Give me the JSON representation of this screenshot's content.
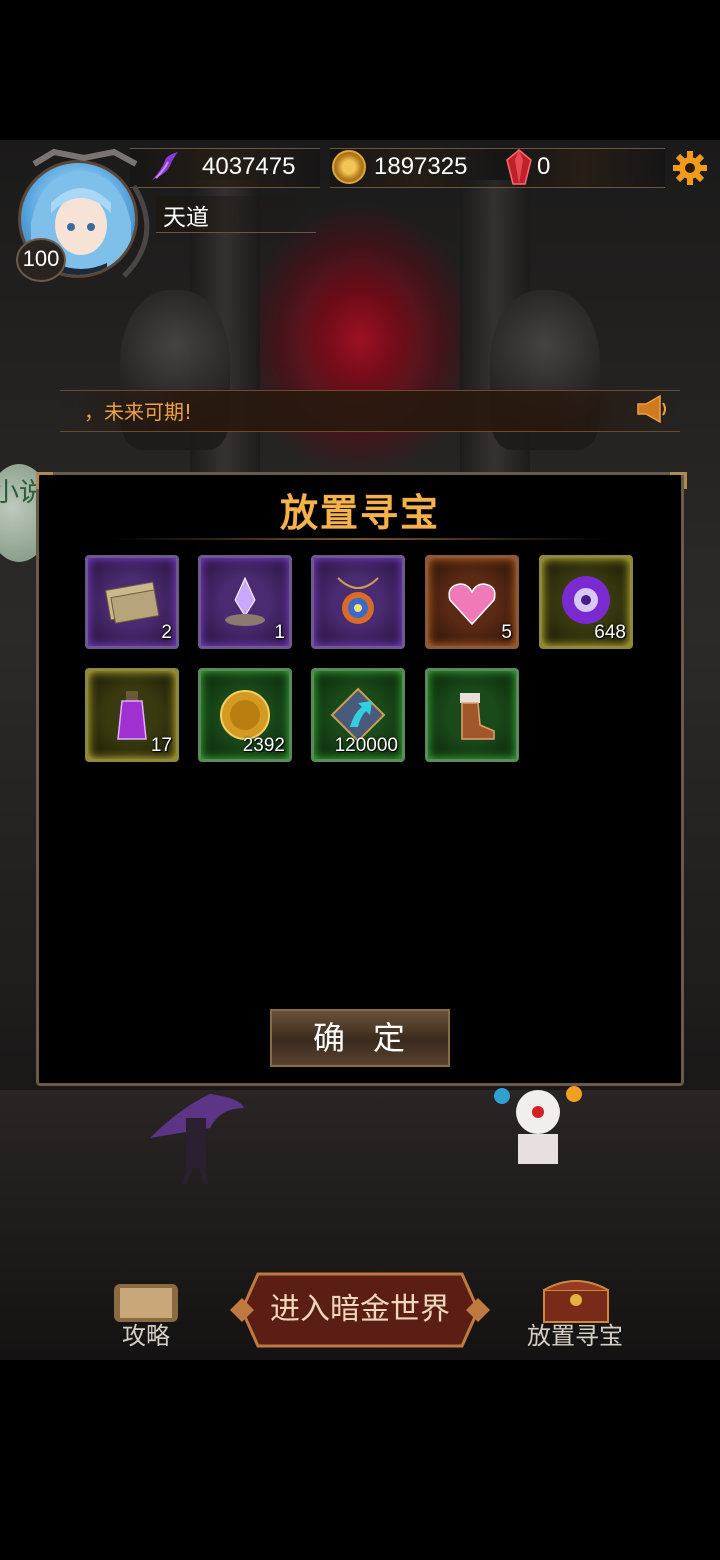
{
  "header": {
    "level": "100",
    "username": "天道",
    "resources": [
      {
        "icon": "wing-icon",
        "value": "4037475"
      },
      {
        "icon": "gold-coin-icon",
        "value": "1897325"
      },
      {
        "icon": "red-gem-icon",
        "value": "0"
      }
    ],
    "settings_icon": "gear-icon"
  },
  "marquee": {
    "text": "，未来可期!",
    "icon": "speaker-icon"
  },
  "side_ball": {
    "text": "小说"
  },
  "modal": {
    "title": "放置寻宝",
    "items": [
      {
        "name": "ticket",
        "rarity": "purple",
        "qty": "2"
      },
      {
        "name": "crystal-altar",
        "rarity": "purple",
        "qty": "1"
      },
      {
        "name": "amulet",
        "rarity": "purple",
        "qty": ""
      },
      {
        "name": "pink-heart-gem",
        "rarity": "orange",
        "qty": "5"
      },
      {
        "name": "purple-orb",
        "rarity": "yellow",
        "qty": "648"
      },
      {
        "name": "purple-potion",
        "rarity": "yellow",
        "qty": "17"
      },
      {
        "name": "gold-coin",
        "rarity": "green",
        "qty": "2392"
      },
      {
        "name": "upgrade-arrow",
        "rarity": "green",
        "qty": "120000"
      },
      {
        "name": "boot",
        "rarity": "green",
        "qty": ""
      }
    ],
    "confirm_label": "确定"
  },
  "bottom_nav": {
    "guide_label": "攻略",
    "enter_label": "进入暗金世界",
    "treasure_label": "放置寻宝"
  },
  "colors": {
    "accent": "#f5b24a",
    "marquee": "#f0a040"
  }
}
